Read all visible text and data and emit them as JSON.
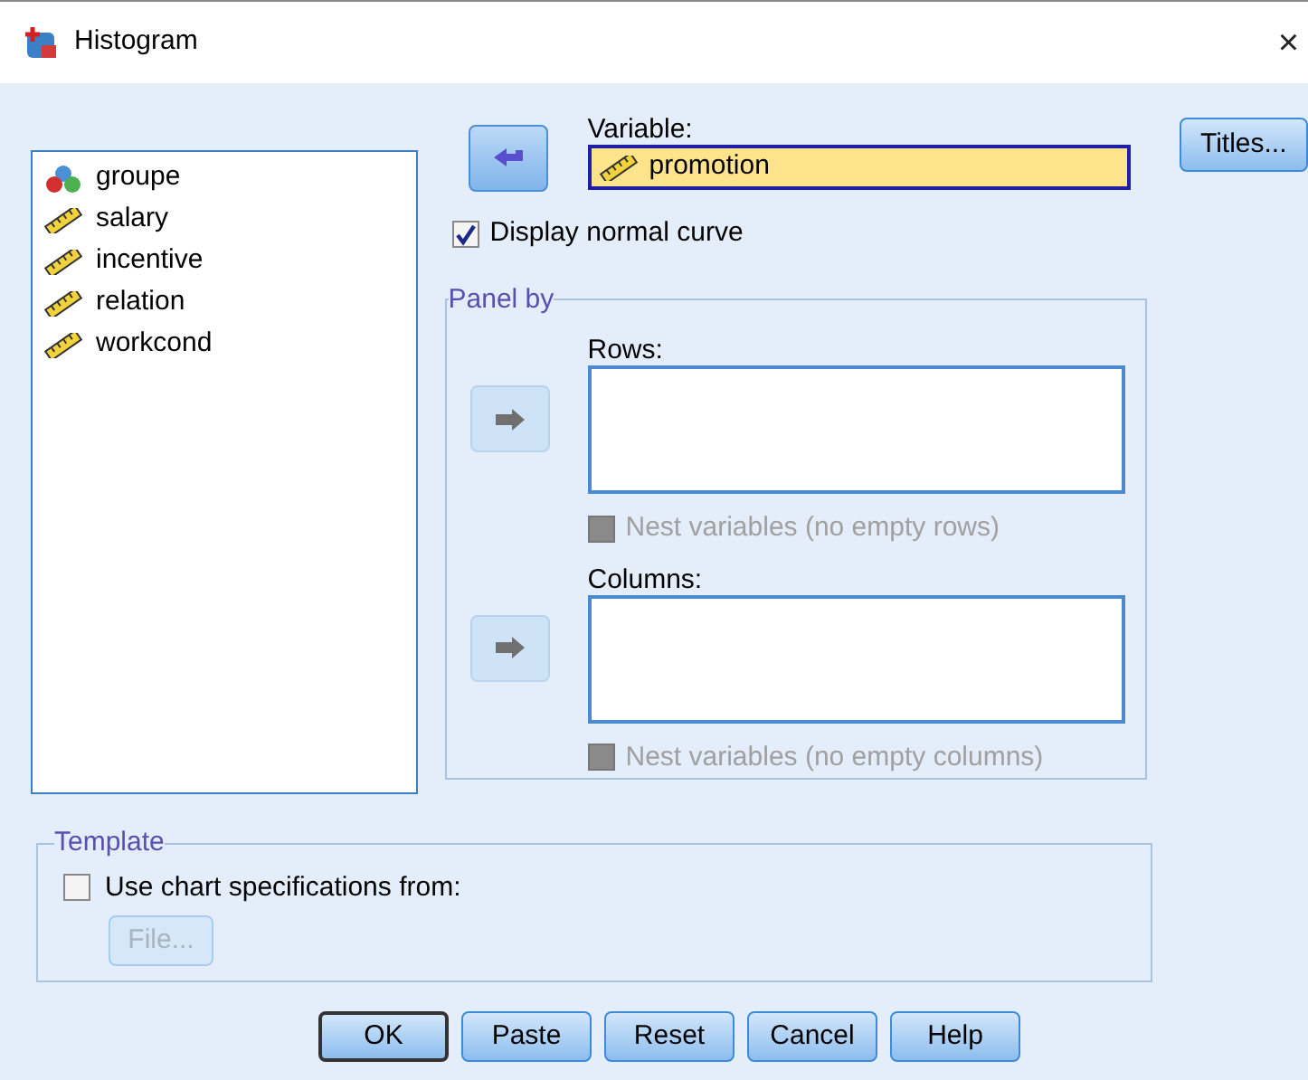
{
  "window": {
    "title": "Histogram",
    "close": "×"
  },
  "variables": [
    {
      "name": "groupe",
      "kind": "nominal"
    },
    {
      "name": "salary",
      "kind": "scale"
    },
    {
      "name": "incentive",
      "kind": "scale"
    },
    {
      "name": "relation",
      "kind": "scale"
    },
    {
      "name": "workcond",
      "kind": "scale"
    }
  ],
  "variable": {
    "label": "Variable:",
    "value": "promotion",
    "kind": "scale",
    "move_disabled": false
  },
  "titles_button": "Titles...",
  "display_normal_curve": {
    "label": "Display normal curve",
    "checked": true
  },
  "panel_by": {
    "title": "Panel by",
    "rows": {
      "label": "Rows:",
      "move_disabled": true,
      "nest": {
        "label": "Nest variables (no empty rows)",
        "checked": false,
        "disabled": true
      }
    },
    "columns": {
      "label": "Columns:",
      "move_disabled": true,
      "nest": {
        "label": "Nest variables (no empty columns)",
        "checked": false,
        "disabled": true
      }
    }
  },
  "template": {
    "title": "Template",
    "use_spec": {
      "label": "Use chart specifications from:",
      "checked": false
    },
    "file_button": {
      "label": "File...",
      "disabled": true
    }
  },
  "buttons": [
    {
      "label": "OK",
      "default": true
    },
    {
      "label": "Paste",
      "default": false
    },
    {
      "label": "Reset",
      "default": false
    },
    {
      "label": "Cancel",
      "default": false
    },
    {
      "label": "Help",
      "default": false
    }
  ]
}
